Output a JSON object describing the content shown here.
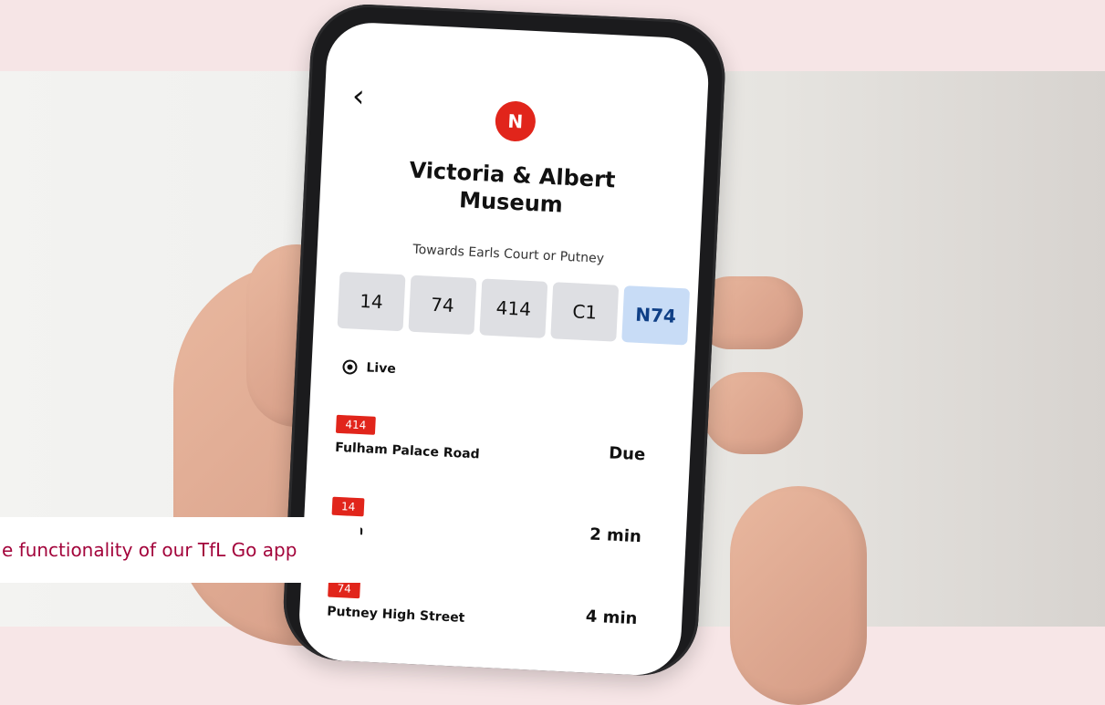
{
  "caption": {
    "text": "e functionality of our TfL Go app"
  },
  "app": {
    "back_symbol": "‹",
    "line_badge": "N",
    "title_line1": "Victoria & Albert",
    "title_line2": "Museum",
    "subtitle": "Towards Earls Court or Putney",
    "routes": [
      {
        "label": "14",
        "selected": false
      },
      {
        "label": "74",
        "selected": false
      },
      {
        "label": "414",
        "selected": false
      },
      {
        "label": "C1",
        "selected": false
      },
      {
        "label": "N74",
        "selected": true
      }
    ],
    "live_label": "Live",
    "arrivals": [
      {
        "route": "414",
        "destination": "Fulham Palace Road",
        "eta": "Due"
      },
      {
        "route": "14",
        "destination": "eath",
        "eta": "2 min"
      },
      {
        "route": "74",
        "destination": "Putney High Street",
        "eta": "4 min"
      }
    ]
  },
  "colors": {
    "tfl_red": "#e1251b",
    "selected_route": "#c8dcf6",
    "caption_text": "#a3043b"
  }
}
